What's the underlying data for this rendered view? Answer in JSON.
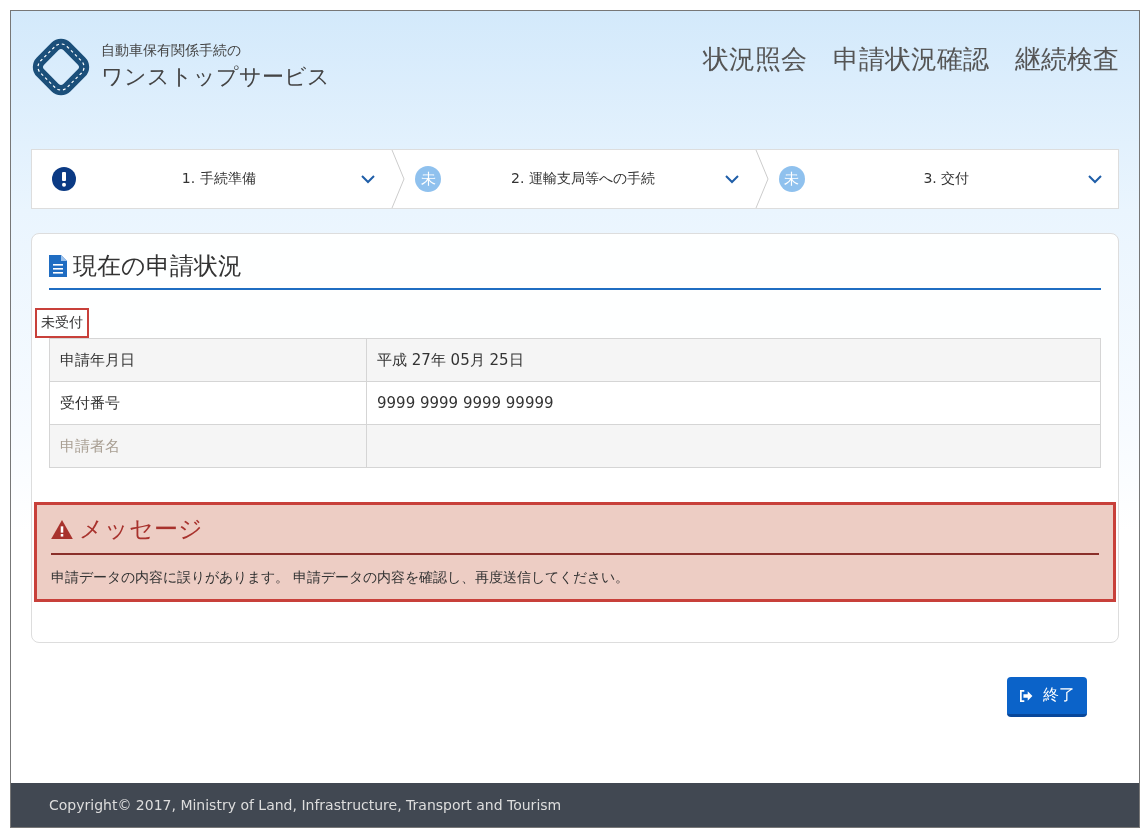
{
  "header": {
    "logo_line1": "自動車保有関係手続の",
    "logo_line2": "ワンストップサービス",
    "nav": [
      "状況照会",
      "申請状況確認",
      "継続検査"
    ]
  },
  "steps": [
    {
      "kind": "alert",
      "label": "1. 手続準備"
    },
    {
      "kind": "pending",
      "badge": "未",
      "label": "2. 運輸支局等への手続"
    },
    {
      "kind": "pending",
      "badge": "未",
      "label": "3. 交付"
    }
  ],
  "status_panel": {
    "title": "現在の申請状況",
    "status": {
      "text": "未受付",
      "highlighted": true
    },
    "rows": [
      {
        "label": "申請年月日",
        "value": "平成 27年 05月 25日",
        "disabled": false
      },
      {
        "label": "受付番号",
        "value": "9999 9999 9999 99999",
        "disabled": false
      },
      {
        "label": "申請者名",
        "disabled": true
      }
    ]
  },
  "message": {
    "title": "メッセージ",
    "text": "申請データの内容に誤りがあります。 申請データの内容を確認し、再度送信してください。",
    "highlighted": true
  },
  "exit_button": {
    "label": "終了"
  },
  "footer": {
    "copyright": "Copyright© 2017, Ministry of Land, Infrastructure, Transport and Tourism"
  }
}
